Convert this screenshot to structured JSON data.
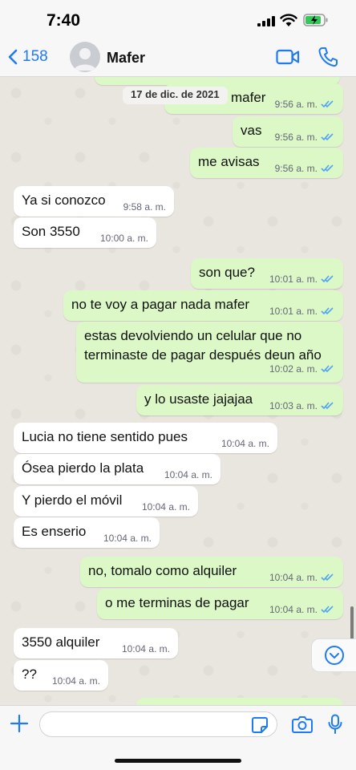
{
  "status_bar": {
    "time": "7:40"
  },
  "header": {
    "back_count": "158",
    "contact_name": "Mafer"
  },
  "chat": {
    "date_chip": "17 de dic. de 2021",
    "messages": [
      {
        "dir": "out",
        "text": "mafer",
        "time": "9:56 a. m.",
        "read": true
      },
      {
        "dir": "out",
        "text": "vas",
        "time": "9:56 a. m.",
        "read": true
      },
      {
        "dir": "out",
        "text": "me avisas",
        "time": "9:56 a. m.",
        "read": true
      },
      {
        "dir": "in",
        "text": "Ya si conozco",
        "time": "9:58 a. m."
      },
      {
        "dir": "in",
        "text": "Son 3550",
        "time": "10:00 a. m."
      },
      {
        "dir": "out",
        "text": "son que?",
        "time": "10:01 a. m.",
        "read": true
      },
      {
        "dir": "out",
        "text": "no te voy a pagar nada mafer",
        "time": "10:01 a. m.",
        "read": true
      },
      {
        "dir": "out",
        "text": "estas devolviendo un celular que no terminaste de pagar después deun año",
        "time": "10:02 a. m.",
        "read": true
      },
      {
        "dir": "out",
        "text": "y lo usaste jajajaa",
        "time": "10:03 a. m.",
        "read": true
      },
      {
        "dir": "in",
        "text": "Lucia no tiene sentido pues",
        "time": "10:04 a. m."
      },
      {
        "dir": "in",
        "text": "Ósea pierdo la plata",
        "time": "10:04 a. m."
      },
      {
        "dir": "in",
        "text": "Y pierdo el móvil",
        "time": "10:04 a. m."
      },
      {
        "dir": "in",
        "text": "Es enserio",
        "time": "10:04 a. m."
      },
      {
        "dir": "out",
        "text": "no, tomalo como alquiler",
        "time": "10:04 a. m.",
        "read": true
      },
      {
        "dir": "out",
        "text": "o me terminas de pagar",
        "time": "10:04 a. m.",
        "read": true
      },
      {
        "dir": "in",
        "text": "3550 alquiler",
        "time": "10:04 a. m."
      },
      {
        "dir": "in",
        "text": "??",
        "time": "10:04 a. m."
      }
    ]
  },
  "colors": {
    "accent": "#1f7bf5",
    "outgoing_bubble": "#dbf8c6",
    "incoming_bubble": "#ffffff",
    "read_ticks": "#4fa3f7"
  },
  "icons": {
    "back": "chevron-left-icon",
    "video": "video-camera-icon",
    "call": "phone-icon",
    "scroll_down": "chevron-down-circle-icon",
    "attach": "plus-icon",
    "sticker": "sticker-icon",
    "camera": "camera-icon",
    "mic": "microphone-icon"
  }
}
